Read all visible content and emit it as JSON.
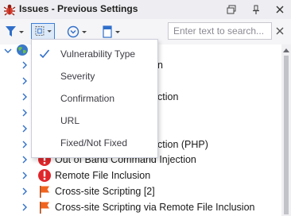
{
  "window": {
    "title": "Issues - Previous Settings",
    "icons": {
      "app": "bug-icon",
      "restore": "restore-window-icon",
      "pin": "pin-icon",
      "close": "close-icon"
    }
  },
  "toolbar": {
    "buttons": [
      {
        "icon": "filter-icon",
        "has_dropdown": true
      },
      {
        "icon": "group-by-icon",
        "has_dropdown": true,
        "active": true
      },
      {
        "icon": "expand-collapse-icon",
        "has_dropdown": true
      },
      {
        "icon": "layout-icon",
        "has_dropdown": true
      }
    ],
    "search": {
      "placeholder": "Enter text to search...",
      "value": ""
    }
  },
  "group_menu": {
    "items": [
      {
        "label": "Vulnerability Type",
        "checked": true
      },
      {
        "label": "Severity",
        "checked": false
      },
      {
        "label": "Confirmation",
        "checked": false
      },
      {
        "label": "URL",
        "checked": false
      },
      {
        "label": "Fixed/Not Fixed",
        "checked": false
      }
    ]
  },
  "tree": {
    "root": {
      "icon": "globe-icon",
      "expanded": true
    },
    "rows": [
      {
        "text": "n",
        "icon": "",
        "visible_suffix": true
      },
      {
        "text": "",
        "icon": ""
      },
      {
        "text": "ction",
        "icon": "",
        "visible_suffix": true
      },
      {
        "text": "",
        "icon": ""
      },
      {
        "text": "",
        "icon": ""
      },
      {
        "text": "",
        "icon": ""
      },
      {
        "text": "ction (PHP)",
        "icon": "",
        "visible_suffix": true
      },
      {
        "text": "Out of Band Command Injection",
        "icon": "critical-severity-icon"
      },
      {
        "text": "Remote File Inclusion",
        "icon": "critical-severity-icon"
      },
      {
        "text": "Cross-site Scripting [2]",
        "icon": "high-severity-flag-icon"
      },
      {
        "text": "Cross-site Scripting via Remote File Inclusion",
        "icon": "high-severity-flag-icon"
      }
    ]
  },
  "colors": {
    "critical": "#e0262b",
    "high": "#f0641f",
    "accent": "#2f6fca",
    "titlebar": "#eeeef2"
  }
}
